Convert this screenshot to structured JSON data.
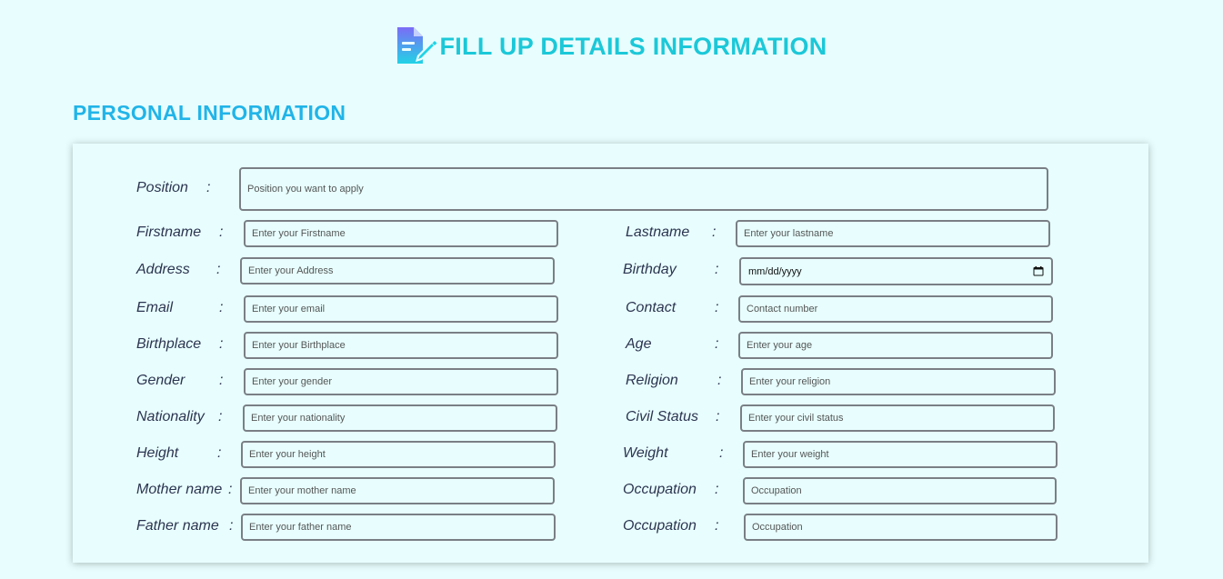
{
  "header": {
    "title": "FILL UP DETAILS INFORMATION"
  },
  "section": {
    "title": "PERSONAL INFORMATION"
  },
  "colon": ":",
  "form": {
    "position": {
      "label": "Position",
      "placeholder": "Position you want to apply"
    },
    "firstname": {
      "label": "Firstname",
      "placeholder": "Enter your Firstname"
    },
    "lastname": {
      "label": "Lastname",
      "placeholder": "Enter your lastname"
    },
    "address": {
      "label": "Address",
      "placeholder": "Enter your Address"
    },
    "birthday": {
      "label": "Birthday",
      "placeholder": "mm/dd/yyyy"
    },
    "email": {
      "label": "Email",
      "placeholder": "Enter your email"
    },
    "contact": {
      "label": "Contact",
      "placeholder": "Contact number"
    },
    "birthplace": {
      "label": "Birthplace",
      "placeholder": "Enter your Birthplace"
    },
    "age": {
      "label": "Age",
      "placeholder": "Enter your age"
    },
    "gender": {
      "label": "Gender",
      "placeholder": "Enter your gender"
    },
    "religion": {
      "label": "Religion",
      "placeholder": "Enter your religion"
    },
    "nationality": {
      "label": "Nationality",
      "placeholder": "Enter your nationality"
    },
    "civil_status": {
      "label": "Civil Status",
      "placeholder": "Enter your civil status"
    },
    "height": {
      "label": "Height",
      "placeholder": "Enter your height"
    },
    "weight": {
      "label": "Weight",
      "placeholder": "Enter your weight"
    },
    "mother_name": {
      "label": "Mother name",
      "placeholder": "Enter your mother name"
    },
    "mother_occupation": {
      "label": "Occupation",
      "placeholder": "Occupation"
    },
    "father_name": {
      "label": "Father name",
      "placeholder": "Enter your father name"
    },
    "father_occupation": {
      "label": "Occupation",
      "placeholder": "Occupation"
    }
  },
  "colors": {
    "background": "#e8fefe",
    "header_title": "#1cc8d8",
    "section_title": "#21b4e8",
    "label_text": "#2c3450",
    "field_border": "#7a7f85"
  },
  "icons": {
    "header": "document-edit-icon",
    "birthday": "calendar-icon"
  }
}
